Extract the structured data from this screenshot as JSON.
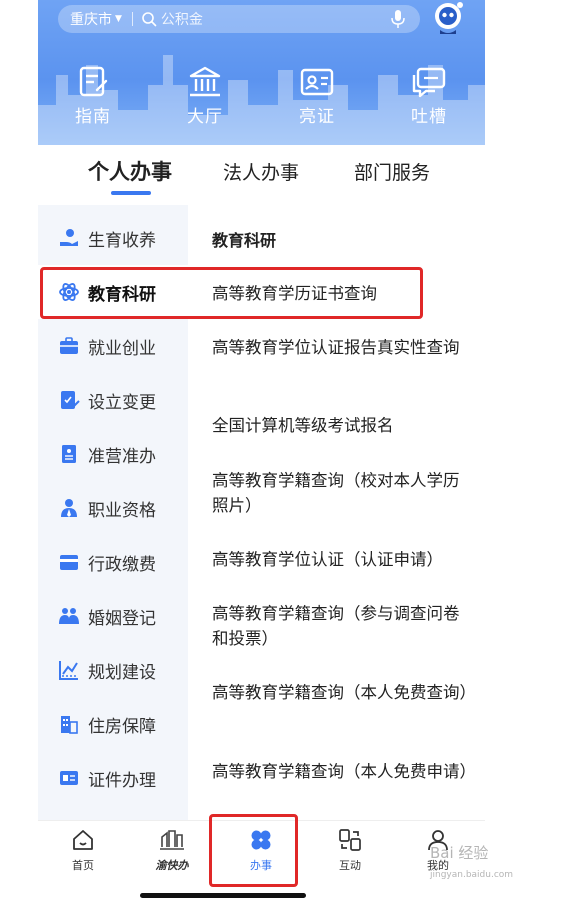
{
  "header": {
    "city": "重庆市",
    "search_placeholder": "公积金",
    "quick_links": [
      {
        "label": "指南",
        "icon": "guide-icon"
      },
      {
        "label": "大厅",
        "icon": "hall-icon"
      },
      {
        "label": "亮证",
        "icon": "id-card-icon"
      },
      {
        "label": "吐槽",
        "icon": "feedback-icon"
      }
    ]
  },
  "tabs": [
    {
      "label": "个人办事",
      "active": true
    },
    {
      "label": "法人办事",
      "active": false
    },
    {
      "label": "部门服务",
      "active": false
    }
  ],
  "sidebar": {
    "items": [
      {
        "label": "生育收养",
        "icon": "hand-heart-icon"
      },
      {
        "label": "教育科研",
        "icon": "atom-icon",
        "active": true
      },
      {
        "label": "就业创业",
        "icon": "briefcase-icon"
      },
      {
        "label": "设立变更",
        "icon": "edit-doc-icon"
      },
      {
        "label": "准营准办",
        "icon": "license-icon"
      },
      {
        "label": "职业资格",
        "icon": "person-badge-icon"
      },
      {
        "label": "行政缴费",
        "icon": "wallet-icon"
      },
      {
        "label": "婚姻登记",
        "icon": "couple-icon"
      },
      {
        "label": "规划建设",
        "icon": "blueprint-icon"
      },
      {
        "label": "住房保障",
        "icon": "building-icon"
      },
      {
        "label": "证件办理",
        "icon": "card-icon"
      }
    ]
  },
  "content": {
    "title": "教育科研",
    "services": [
      "高等教育学历证书查询",
      "高等教育学位认证报告真实性查询",
      "全国计算机等级考试报名",
      "高等教育学籍查询（校对本人学历照片）",
      "高等教育学位认证（认证申请）",
      "高等教育学籍查询（参与调查问卷和投票）",
      "高等教育学籍查询（本人免费查询）",
      "高等教育学籍查询（本人免费申请）"
    ]
  },
  "bottom_nav": [
    {
      "label": "首页",
      "icon": "home-icon"
    },
    {
      "label": "渝快办",
      "icon": "yukuaiban-logo-icon"
    },
    {
      "label": "办事",
      "icon": "grid-clover-icon",
      "active": true
    },
    {
      "label": "互动",
      "icon": "interact-icon"
    },
    {
      "label": "我的",
      "icon": "user-icon"
    }
  ],
  "watermark": {
    "text": "Bai 经验",
    "url": "jingyan.baidu.com"
  },
  "colors": {
    "accent": "#3a78f0",
    "highlight": "#e02828",
    "banner": "#6fa3f4",
    "sidebar_bg": "#f3f6fb"
  }
}
